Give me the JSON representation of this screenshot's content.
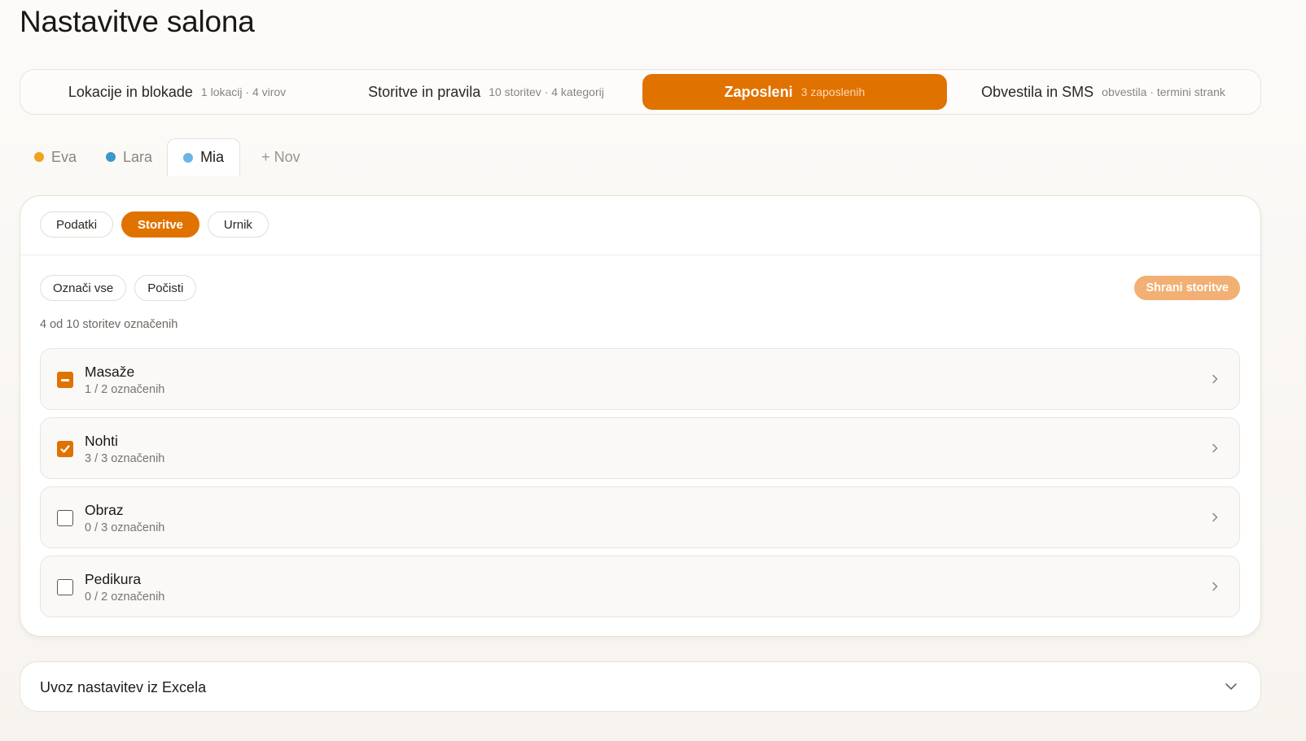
{
  "page": {
    "title": "Nastavitve salona"
  },
  "top_tabs": [
    {
      "label": "Lokacije in blokade",
      "sub": "1 lokacij · 4 virov",
      "active": false
    },
    {
      "label": "Storitve in pravila",
      "sub": "10 storitev · 4 kategorij",
      "active": false
    },
    {
      "label": "Zaposleni",
      "sub": "3 zaposlenih",
      "active": true
    },
    {
      "label": "Obvestila in SMS",
      "sub": "obvestila · termini strank",
      "active": false
    }
  ],
  "employees": [
    {
      "name": "Eva",
      "color": "#f2a21b",
      "active": false
    },
    {
      "name": "Lara",
      "color": "#3d97c9",
      "active": false
    },
    {
      "name": "Mia",
      "color": "#6db4e8",
      "active": true
    }
  ],
  "new_employee_label": "+ Nov",
  "subtabs": [
    {
      "label": "Podatki",
      "active": false
    },
    {
      "label": "Storitve",
      "active": true
    },
    {
      "label": "Urnik",
      "active": false
    }
  ],
  "actions": {
    "select_all": "Označi vse",
    "clear": "Počisti",
    "save": "Shrani storitve"
  },
  "selection_summary": "4 od 10 storitev označenih",
  "categories": [
    {
      "name": "Masaže",
      "count": "1 / 2 označenih",
      "state": "partial"
    },
    {
      "name": "Nohti",
      "count": "3 / 3 označenih",
      "state": "checked"
    },
    {
      "name": "Obraz",
      "count": "0 / 3 označenih",
      "state": "unchecked"
    },
    {
      "name": "Pedikura",
      "count": "0 / 2 označenih",
      "state": "unchecked"
    }
  ],
  "import_panel": {
    "title": "Uvoz nastavitev iz Excela"
  },
  "colors": {
    "accent": "#e07200",
    "accent_soft": "#f2b074"
  },
  "icons": {
    "chevron": "chevron-right-icon",
    "expand": "chevron-down-icon",
    "check": "check-icon",
    "dash": "minus-icon"
  }
}
